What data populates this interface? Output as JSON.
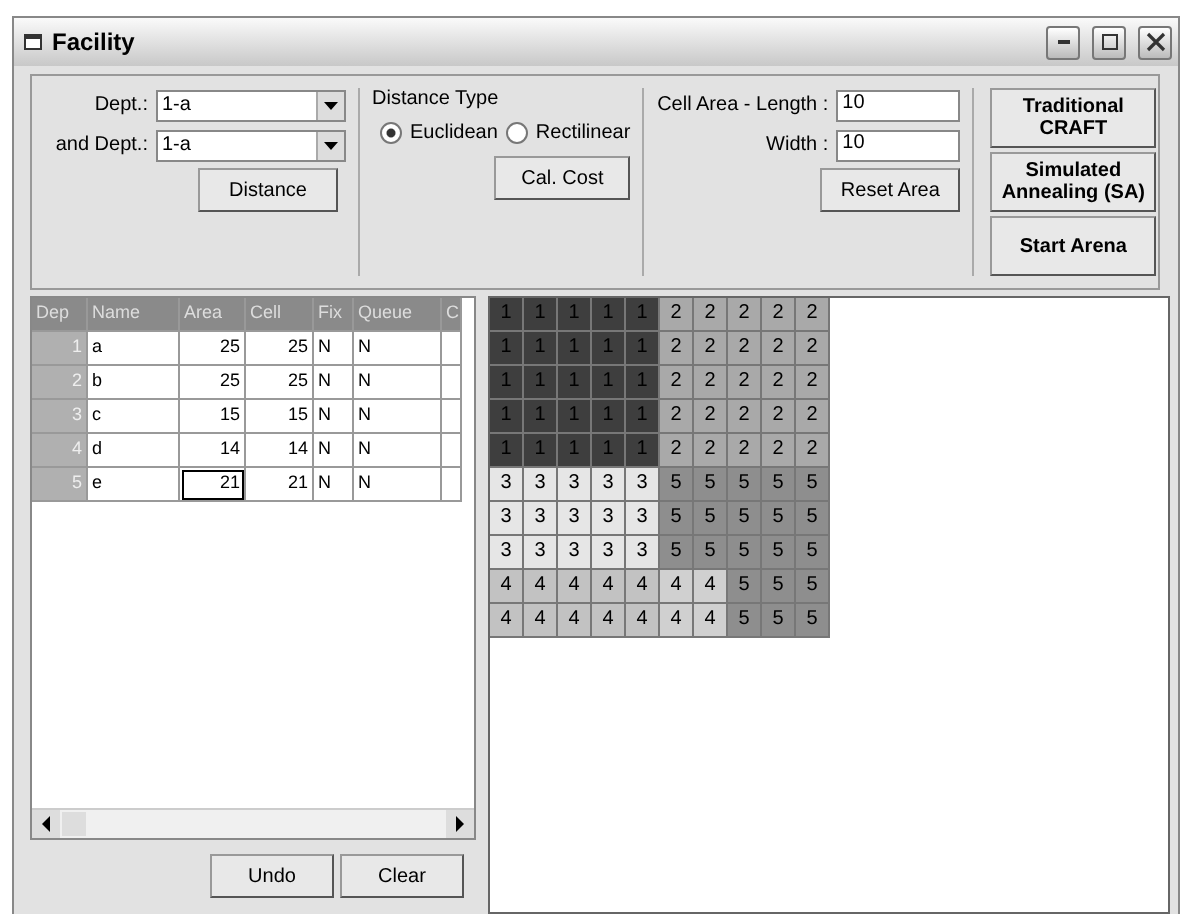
{
  "window": {
    "title": "Facility"
  },
  "dept_selectors": [
    {
      "label": "Dept.:",
      "value": "1-a"
    },
    {
      "label": "and Dept.:",
      "value": "1-a"
    }
  ],
  "distance_button": "Distance",
  "distance_type": {
    "title": "Distance Type",
    "options": [
      {
        "label": "Euclidean",
        "selected": true
      },
      {
        "label": "Rectilinear",
        "selected": false
      }
    ],
    "button": "Cal. Cost"
  },
  "cell_area": {
    "fields": [
      {
        "label": "Cell Area - Length :",
        "value": "10"
      },
      {
        "label": "Width :",
        "value": "10"
      }
    ],
    "button": "Reset Area"
  },
  "actions": [
    "Traditional\nCRAFT",
    "Simulated\nAnnealing (SA)",
    "Start Arena"
  ],
  "table": {
    "columns": [
      "Dep",
      "Name",
      "Area",
      "Cell",
      "Fix",
      "Queue",
      "C"
    ],
    "rows": [
      {
        "cells": [
          "1",
          "a",
          "25",
          "25",
          "N",
          "N"
        ],
        "area_focused": false
      },
      {
        "cells": [
          "2",
          "b",
          "25",
          "25",
          "N",
          "N"
        ],
        "area_focused": false
      },
      {
        "cells": [
          "3",
          "c",
          "15",
          "15",
          "N",
          "N"
        ],
        "area_focused": false
      },
      {
        "cells": [
          "4",
          "d",
          "14",
          "14",
          "N",
          "N"
        ],
        "area_focused": false
      },
      {
        "cells": [
          "5",
          "e",
          "21",
          "21",
          "N",
          "N"
        ],
        "area_focused": true
      }
    ]
  },
  "bottom_buttons": [
    "Undo",
    "Clear"
  ],
  "layout_grid": {
    "rows": [
      [
        {
          "text": "1",
          "color": "#3e3e3e"
        },
        {
          "text": "1",
          "color": "#3e3e3e"
        },
        {
          "text": "1",
          "color": "#3e3e3e"
        },
        {
          "text": "1",
          "color": "#3e3e3e"
        },
        {
          "text": "1",
          "color": "#3e3e3e"
        },
        {
          "text": "2",
          "color": "#a9a9a9"
        },
        {
          "text": "2",
          "color": "#a9a9a9"
        },
        {
          "text": "2",
          "color": "#a9a9a9"
        },
        {
          "text": "2",
          "color": "#a9a9a9"
        },
        {
          "text": "2",
          "color": "#a9a9a9"
        }
      ],
      [
        {
          "text": "1",
          "color": "#3e3e3e"
        },
        {
          "text": "1",
          "color": "#3e3e3e"
        },
        {
          "text": "1",
          "color": "#3e3e3e"
        },
        {
          "text": "1",
          "color": "#3e3e3e"
        },
        {
          "text": "1",
          "color": "#3e3e3e"
        },
        {
          "text": "2",
          "color": "#a9a9a9"
        },
        {
          "text": "2",
          "color": "#a9a9a9"
        },
        {
          "text": "2",
          "color": "#a9a9a9"
        },
        {
          "text": "2",
          "color": "#a9a9a9"
        },
        {
          "text": "2",
          "color": "#a9a9a9"
        }
      ],
      [
        {
          "text": "1",
          "color": "#3e3e3e"
        },
        {
          "text": "1",
          "color": "#3e3e3e"
        },
        {
          "text": "1",
          "color": "#3e3e3e"
        },
        {
          "text": "1",
          "color": "#3e3e3e"
        },
        {
          "text": "1",
          "color": "#3e3e3e"
        },
        {
          "text": "2",
          "color": "#a9a9a9"
        },
        {
          "text": "2",
          "color": "#a9a9a9"
        },
        {
          "text": "2",
          "color": "#a9a9a9"
        },
        {
          "text": "2",
          "color": "#a9a9a9"
        },
        {
          "text": "2",
          "color": "#a9a9a9"
        }
      ],
      [
        {
          "text": "1",
          "color": "#3e3e3e"
        },
        {
          "text": "1",
          "color": "#3e3e3e"
        },
        {
          "text": "1",
          "color": "#3e3e3e"
        },
        {
          "text": "1",
          "color": "#3e3e3e"
        },
        {
          "text": "1",
          "color": "#3e3e3e"
        },
        {
          "text": "2",
          "color": "#a9a9a9"
        },
        {
          "text": "2",
          "color": "#a9a9a9"
        },
        {
          "text": "2",
          "color": "#a9a9a9"
        },
        {
          "text": "2",
          "color": "#a9a9a9"
        },
        {
          "text": "2",
          "color": "#a9a9a9"
        }
      ],
      [
        {
          "text": "1",
          "color": "#3e3e3e"
        },
        {
          "text": "1",
          "color": "#3e3e3e"
        },
        {
          "text": "1",
          "color": "#3e3e3e"
        },
        {
          "text": "1",
          "color": "#3e3e3e"
        },
        {
          "text": "1",
          "color": "#3e3e3e"
        },
        {
          "text": "2",
          "color": "#a9a9a9"
        },
        {
          "text": "2",
          "color": "#a9a9a9"
        },
        {
          "text": "2",
          "color": "#a9a9a9"
        },
        {
          "text": "2",
          "color": "#a9a9a9"
        },
        {
          "text": "2",
          "color": "#a9a9a9"
        }
      ],
      [
        {
          "text": "3",
          "color": "#e6e6e6"
        },
        {
          "text": "3",
          "color": "#e6e6e6"
        },
        {
          "text": "3",
          "color": "#e6e6e6"
        },
        {
          "text": "3",
          "color": "#e6e6e6"
        },
        {
          "text": "3",
          "color": "#e6e6e6"
        },
        {
          "text": "5",
          "color": "#8e8e8e"
        },
        {
          "text": "5",
          "color": "#8e8e8e"
        },
        {
          "text": "5",
          "color": "#8e8e8e"
        },
        {
          "text": "5",
          "color": "#8e8e8e"
        },
        {
          "text": "5",
          "color": "#8e8e8e"
        }
      ],
      [
        {
          "text": "3",
          "color": "#e6e6e6"
        },
        {
          "text": "3",
          "color": "#e6e6e6"
        },
        {
          "text": "3",
          "color": "#e6e6e6"
        },
        {
          "text": "3",
          "color": "#e6e6e6"
        },
        {
          "text": "3",
          "color": "#e6e6e6"
        },
        {
          "text": "5",
          "color": "#8e8e8e"
        },
        {
          "text": "5",
          "color": "#8e8e8e"
        },
        {
          "text": "5",
          "color": "#8e8e8e"
        },
        {
          "text": "5",
          "color": "#8e8e8e"
        },
        {
          "text": "5",
          "color": "#8e8e8e"
        }
      ],
      [
        {
          "text": "3",
          "color": "#e6e6e6"
        },
        {
          "text": "3",
          "color": "#e6e6e6"
        },
        {
          "text": "3",
          "color": "#e6e6e6"
        },
        {
          "text": "3",
          "color": "#e6e6e6"
        },
        {
          "text": "3",
          "color": "#e6e6e6"
        },
        {
          "text": "5",
          "color": "#8e8e8e"
        },
        {
          "text": "5",
          "color": "#8e8e8e"
        },
        {
          "text": "5",
          "color": "#8e8e8e"
        },
        {
          "text": "5",
          "color": "#8e8e8e"
        },
        {
          "text": "5",
          "color": "#8e8e8e"
        }
      ],
      [
        {
          "text": "4",
          "color": "#c2c2c2"
        },
        {
          "text": "4",
          "color": "#c2c2c2"
        },
        {
          "text": "4",
          "color": "#c2c2c2"
        },
        {
          "text": "4",
          "color": "#c2c2c2"
        },
        {
          "text": "4",
          "color": "#c2c2c2"
        },
        {
          "text": "4",
          "color": "#d0d0d0"
        },
        {
          "text": "4",
          "color": "#d0d0d0"
        },
        {
          "text": "5",
          "color": "#8e8e8e"
        },
        {
          "text": "5",
          "color": "#8e8e8e"
        },
        {
          "text": "5",
          "color": "#8e8e8e"
        }
      ],
      [
        {
          "text": "4",
          "color": "#c2c2c2"
        },
        {
          "text": "4",
          "color": "#c2c2c2"
        },
        {
          "text": "4",
          "color": "#c2c2c2"
        },
        {
          "text": "4",
          "color": "#c2c2c2"
        },
        {
          "text": "4",
          "color": "#c2c2c2"
        },
        {
          "text": "4",
          "color": "#d0d0d0"
        },
        {
          "text": "4",
          "color": "#d0d0d0"
        },
        {
          "text": "5",
          "color": "#8e8e8e"
        },
        {
          "text": "5",
          "color": "#8e8e8e"
        },
        {
          "text": "5",
          "color": "#8e8e8e"
        }
      ]
    ]
  }
}
